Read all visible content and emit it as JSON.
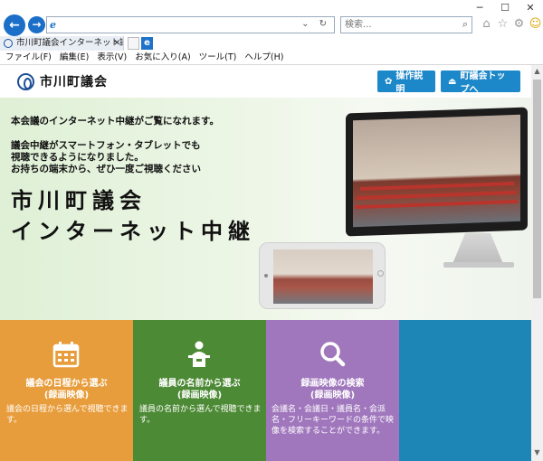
{
  "browser": {
    "window_controls": [
      "─",
      "☐",
      "✕"
    ],
    "address": {
      "value": "",
      "tools": "⌄ ↻"
    },
    "search": {
      "placeholder": "検索..."
    },
    "tab": {
      "title": "市川町議会インターネット議会..."
    },
    "menu": [
      "ファイル(F)",
      "編集(E)",
      "表示(V)",
      "お気に入り(A)",
      "ツール(T)",
      "ヘルプ(H)"
    ]
  },
  "header": {
    "site_name": "市川町議会",
    "help_button": "操作説明",
    "top_button": "町議会トップへ"
  },
  "hero": {
    "lead": "本会議のインターネット中継がご覧になれます。",
    "sub_line1": "議会中継がスマートフォン・タブレットでも",
    "sub_line2": "視聴できるようになりました。",
    "sub_line3": "お持ちの端末から、ぜひ一度ご視聴ください",
    "title_line1": "市川町議会",
    "title_line2": "インターネット中継"
  },
  "tiles": [
    {
      "title_line1": "議会の日程から選ぶ",
      "title_line2": "(録画映像)",
      "desc": "議会の日程から選んで視聴できます。",
      "icon": "calendar-icon",
      "color": "#e89d3c"
    },
    {
      "title_line1": "議員の名前から選ぶ",
      "title_line2": "(録画映像)",
      "desc": "議員の名前から選んで視聴できます。",
      "icon": "speaker-podium-icon",
      "color": "#4d8a35"
    },
    {
      "title_line1": "録画映像の検索",
      "title_line2": "(録画映像)",
      "desc": "会議名・会議日・議員名・会派名・フリーキーワードの条件で映像を検索することができます。",
      "icon": "search-icon",
      "color": "#a077bd"
    },
    {
      "title_line1": "",
      "title_line2": "",
      "desc": "",
      "icon": "",
      "color": "#1d86b6"
    }
  ]
}
